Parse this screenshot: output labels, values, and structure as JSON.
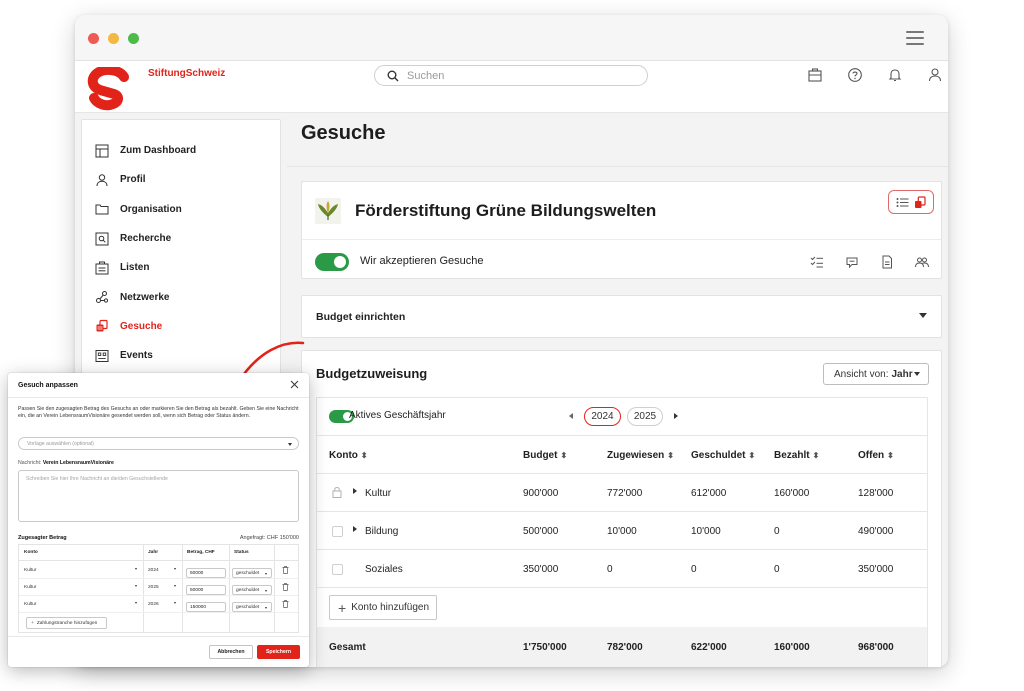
{
  "brand": {
    "name": "StiftungSchweiz",
    "accent": "#e2231a"
  },
  "search": {
    "placeholder": "Suchen"
  },
  "header_icons": [
    "briefcase-icon",
    "help-icon",
    "bell-icon",
    "user-icon"
  ],
  "sidebar": {
    "items": [
      {
        "label": "Zum Dashboard",
        "icon": "dashboard-icon",
        "active": false
      },
      {
        "label": "Profil",
        "icon": "profile-icon",
        "active": false
      },
      {
        "label": "Organisation",
        "icon": "folder-icon",
        "active": false
      },
      {
        "label": "Recherche",
        "icon": "search-box-icon",
        "active": false
      },
      {
        "label": "Listen",
        "icon": "list-icon",
        "active": false
      },
      {
        "label": "Netzwerke",
        "icon": "network-icon",
        "active": false
      },
      {
        "label": "Gesuche",
        "icon": "coins-icon",
        "active": true
      },
      {
        "label": "Events",
        "icon": "events-icon",
        "active": false
      }
    ]
  },
  "page": {
    "title": "Gesuche"
  },
  "organization": {
    "name": "Förderstiftung Grüne Bildungswelten",
    "accept_label": "Wir akzeptieren Gesuche",
    "accept_enabled": true,
    "action_icons": [
      "checklist-icon",
      "chat-icon",
      "document-icon",
      "group-icon"
    ]
  },
  "budget_setup": {
    "label": "Budget einrichten"
  },
  "allocation": {
    "title": "Budgetzuweisung",
    "view_prefix": "Ansicht von:",
    "view_value": "Jahr",
    "fiscal_year_label": "Aktives Geschäftsjahr",
    "fiscal_year_enabled": true,
    "years": [
      "2024",
      "2025"
    ],
    "selected_year": "2024",
    "columns": [
      "Konto",
      "Budget",
      "Zugewiesen",
      "Geschuldet",
      "Bezahlt",
      "Offen"
    ],
    "rows": [
      {
        "konto": "Kultur",
        "budget": "900'000",
        "zugewiesen": "772'000",
        "geschuldet": "612'000",
        "bezahlt": "160'000",
        "offen": "128'000",
        "locked": true,
        "expandable": true
      },
      {
        "konto": "Bildung",
        "budget": "500'000",
        "zugewiesen": "10'000",
        "geschuldet": "10'000",
        "bezahlt": "0",
        "offen": "490'000",
        "locked": false,
        "expandable": true
      },
      {
        "konto": "Soziales",
        "budget": "350'000",
        "zugewiesen": "0",
        "geschuldet": "0",
        "bezahlt": "0",
        "offen": "350'000",
        "locked": false,
        "expandable": false
      }
    ],
    "add_account_label": "Konto hinzufügen",
    "total": {
      "label": "Gesamt",
      "budget": "1'750'000",
      "zugewiesen": "782'000",
      "geschuldet": "622'000",
      "bezahlt": "160'000",
      "offen": "968'000"
    }
  },
  "modal": {
    "title": "Gesuch anpassen",
    "description": "Passen Sie den zugesagten Betrag des Gesuchs an oder markieren Sie den Betrag als bezahlt. Geben Sie eine Nachricht ein, die an Verein LebensraumVisionäre gesendet werden soll, wenn sich Betrag oder Status ändern.",
    "template_placeholder": "Vorlage auswählen (optional)",
    "message_label": "Nachricht:",
    "message_recipient": "Verein LebensraumVisionäre",
    "message_placeholder": "Schreiben Sie hier Ihre Nachricht an die/den Gesuchstellende",
    "pledged_label": "Zugesagter Betrag",
    "requested_label": "Angefragt: CHF 150'000",
    "columns": [
      "Konto",
      "Jahr",
      "Betrag, CHF",
      "Status"
    ],
    "rows": [
      {
        "konto": "Kultur",
        "jahr": "2024",
        "betrag": "50000",
        "status": "geschuldet"
      },
      {
        "konto": "Kultur",
        "jahr": "2025",
        "betrag": "50000",
        "status": "geschuldet"
      },
      {
        "konto": "Kultur",
        "jahr": "2026",
        "betrag": "150000",
        "status": "geschuldet"
      }
    ],
    "add_tranche_label": "Zahlungstranche hinzufügen",
    "cancel_label": "Abbrechen",
    "save_label": "Speichern"
  }
}
